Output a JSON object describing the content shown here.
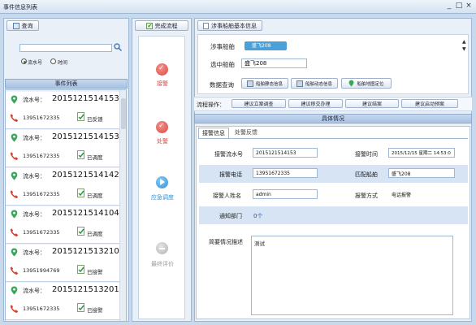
{
  "window": {
    "title": "事件信息列表",
    "controls": [
      "_",
      "□",
      "×"
    ]
  },
  "query": {
    "button": "查询",
    "search_value": "",
    "radio": [
      {
        "label": "流水号",
        "checked": true
      },
      {
        "label": "时间",
        "checked": false
      }
    ]
  },
  "list": {
    "header": "事件列表",
    "flow_label": "流水号：",
    "items": [
      {
        "serial": "2015121514153",
        "phone": "13951672335",
        "status": "已反馈"
      },
      {
        "serial": "2015121514153",
        "phone": "13951672335",
        "status": "已调度"
      },
      {
        "serial": "2015121514142",
        "phone": "13951672335",
        "status": "已调度"
      },
      {
        "serial": "2015121514104",
        "phone": "13951672335",
        "status": "已调度"
      },
      {
        "serial": "2015121513210",
        "phone": "13951994769",
        "status": "已接警"
      },
      {
        "serial": "2015121513201",
        "phone": "13951672335",
        "status": "已接警"
      }
    ]
  },
  "flow": {
    "button": "完成流程",
    "steps": [
      {
        "label": "接警",
        "color": "#e6574f",
        "active": true
      },
      {
        "label": "处警",
        "color": "#e6574f",
        "active": true
      },
      {
        "label": "应急调度",
        "color": "#3aa0e0",
        "active": true
      },
      {
        "label": "最终评价",
        "color": "#b8b8b8",
        "active": false
      }
    ]
  },
  "ship": {
    "button": "涉事船舶基本信息",
    "involved_label": "涉事船舶",
    "involved_value": "盛飞208",
    "selected_label": "选中船舶",
    "selected_value": "盛飞208",
    "data_query_label": "数据查询",
    "data_buttons": [
      "船舶静态信息",
      "船舶动态信息",
      "船舶地图定位"
    ]
  },
  "process": {
    "label": "流程操作：",
    "buttons": [
      "建议立案调查",
      "建议移交办理",
      "建议结案",
      "建议启动预案"
    ]
  },
  "detail": {
    "header": "具体情况",
    "tabs": [
      "接警信息",
      "处警反馈"
    ],
    "fields": {
      "serial_label": "接警流水号",
      "serial_value": "2015121514153",
      "time_label": "接警时间",
      "time_value": "2015/12/15 星期二 14:53:0",
      "phone_label": "报警电话",
      "phone_value": "13951672335",
      "match_label": "匹配船舶",
      "match_value": "盛飞208",
      "name_label": "接警人姓名",
      "name_value": "admin",
      "method_label": "报警方式",
      "method_value": "电话报警",
      "dept_label": "通知部门",
      "dept_value": "0个",
      "desc_label": "简要情况描述",
      "desc_value": "测试"
    }
  }
}
